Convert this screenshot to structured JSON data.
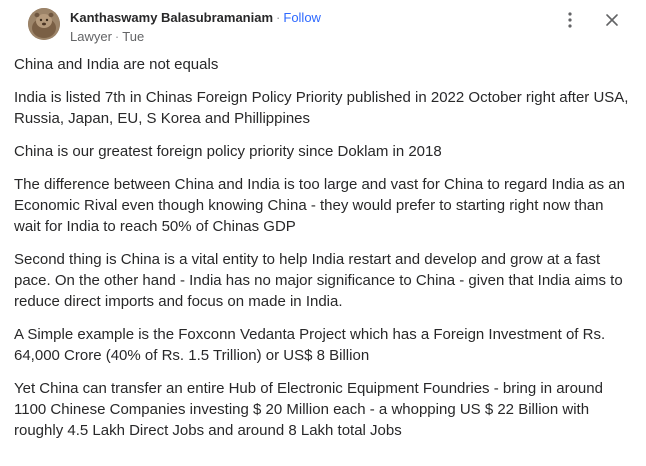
{
  "author": {
    "name": "Kanthaswamy Balasubramaniam",
    "separator": "·",
    "follow_label": "Follow",
    "credential": "Lawyer",
    "date": "Tue"
  },
  "icons": {
    "more": "more-vertical-icon",
    "close": "close-icon"
  },
  "colors": {
    "follow": "#2e69ff",
    "text": "#282829",
    "meta": "#636466"
  },
  "answer": {
    "paragraphs": [
      "China and India are not equals",
      "India is listed 7th in Chinas Foreign Policy Priority published in 2022 October right after USA, Russia, Japan, EU, S Korea and Phillippines",
      "China is our greatest foreign policy priority since Doklam in 2018",
      "The difference between China and India is too large and vast for China to regard India as an Economic Rival even though knowing China - they would prefer to starting right now than wait for India to reach 50% of Chinas GDP",
      "Second thing is China is a vital entity to help India restart and develop and grow at a fast pace. On the other hand - India has no major significance to China - given that India aims to reduce direct imports and focus on made in India.",
      "A Simple example is the Foxconn Vedanta Project which has a Foreign Investment of Rs. 64,000 Crore (40% of Rs. 1.5 Trillion) or US$ 8 Billion",
      "Yet China can transfer an entire Hub of Electronic Equipment Foundries - bring in around 1100 Chinese Companies investing $ 20 Million each - a whopping US $ 22 Billion with roughly 4.5 Lakh Direct Jobs and around 8 Lakh total Jobs"
    ]
  }
}
